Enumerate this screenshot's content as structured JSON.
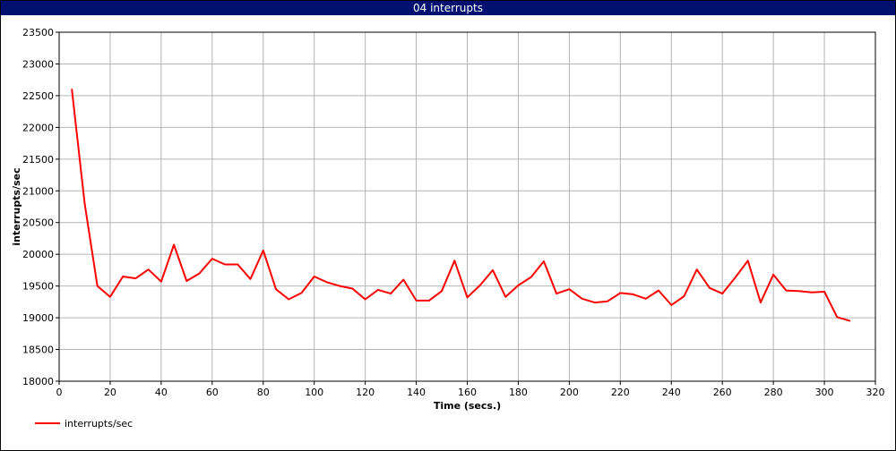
{
  "chart_data": {
    "type": "line",
    "title": "04 interrupts",
    "xlabel": "Time (secs.)",
    "ylabel": "interrupts/sec",
    "xlim": [
      0,
      320
    ],
    "ylim": [
      18000,
      23500
    ],
    "xticks": [
      0,
      20,
      40,
      60,
      80,
      100,
      120,
      140,
      160,
      180,
      200,
      220,
      240,
      260,
      280,
      300,
      320
    ],
    "yticks": [
      18000,
      18500,
      19000,
      19500,
      20000,
      20500,
      21000,
      21500,
      22000,
      22500,
      23000,
      23500
    ],
    "grid": true,
    "legend_position": "bottom-left",
    "series": [
      {
        "name": "interrupts/sec",
        "color": "#ff0000",
        "x": [
          5,
          10,
          15,
          20,
          25,
          30,
          35,
          40,
          45,
          50,
          55,
          60,
          65,
          70,
          75,
          80,
          85,
          90,
          95,
          100,
          105,
          110,
          115,
          120,
          125,
          130,
          135,
          140,
          145,
          150,
          155,
          160,
          165,
          170,
          175,
          180,
          185,
          190,
          195,
          200,
          205,
          210,
          215,
          220,
          225,
          230,
          235,
          240,
          245,
          250,
          255,
          260,
          265,
          270,
          275,
          280,
          285,
          290,
          295,
          300,
          305,
          310
        ],
        "y": [
          22600,
          20800,
          19500,
          19330,
          19650,
          19620,
          19760,
          19570,
          20150,
          19580,
          19700,
          19930,
          19840,
          19840,
          19610,
          20060,
          19450,
          19290,
          19390,
          19650,
          19560,
          19500,
          19460,
          19290,
          19440,
          19380,
          19600,
          19270,
          19270,
          19420,
          19900,
          19320,
          19510,
          19750,
          19330,
          19510,
          19640,
          19890,
          19380,
          19450,
          19300,
          19240,
          19260,
          19390,
          19370,
          19300,
          19430,
          19200,
          19340,
          19760,
          19470,
          19380,
          19630,
          19900,
          19240,
          19680,
          19430,
          19420,
          19400,
          19410,
          19010,
          18950
        ]
      }
    ]
  }
}
